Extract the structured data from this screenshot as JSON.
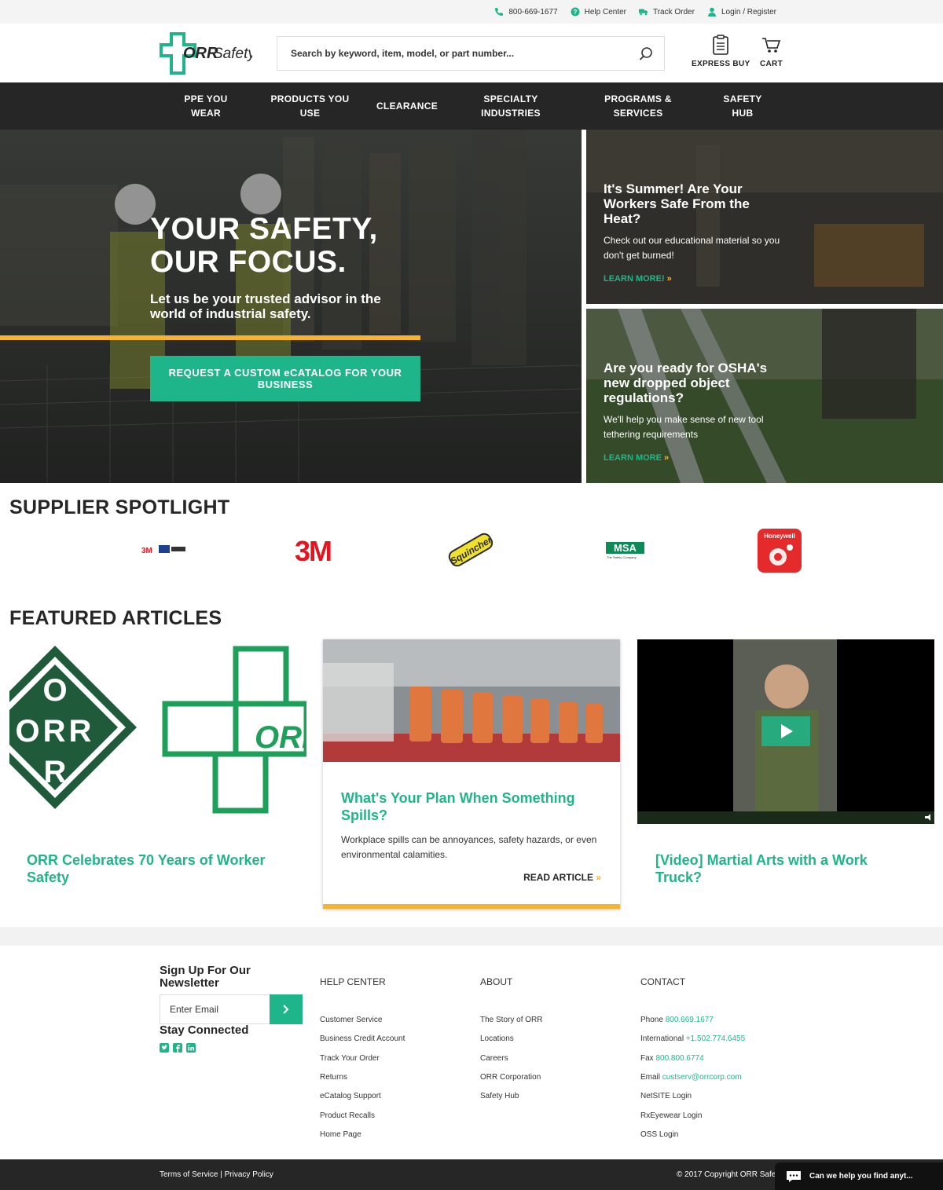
{
  "utility": {
    "phone": "800-669-1677",
    "help": "Help Center",
    "track": "Track Order",
    "login": "Login / Register"
  },
  "header": {
    "logo_text": "ORR Safety",
    "search_placeholder": "Search by keyword, item, model, or part number...",
    "express_buy": "EXPRESS BUY",
    "cart": "CART"
  },
  "nav": [
    {
      "line1": "PPE YOU",
      "line2": "WEAR"
    },
    {
      "line1": "PRODUCTS YOU",
      "line2": "USE"
    },
    {
      "line1": "CLEARANCE",
      "line2": ""
    },
    {
      "line1": "SPECIALTY",
      "line2": "INDUSTRIES"
    },
    {
      "line1": "PROGRAMS &",
      "line2": "SERVICES"
    },
    {
      "line1": "SAFETY",
      "line2": "HUB"
    }
  ],
  "hero": {
    "title_line1": "YOUR SAFETY,",
    "title_line2": "OUR FOCUS.",
    "subtitle": "Let us be your trusted advisor in the world of industrial safety.",
    "cta_line1": "REQUEST A CUSTOM eCATALOG FOR YOUR",
    "cta_line2": "BUSINESS"
  },
  "side_promos": [
    {
      "title": "It's Summer! Are Your Workers Safe From the Heat?",
      "text": "Check out our educational material so you don't get burned!",
      "link": "LEARN MORE!"
    },
    {
      "title": "Are you ready for OSHA's new dropped object regulations?",
      "text": "We'll help you make sense of new tool tethering requirements",
      "link": "LEARN MORE"
    }
  ],
  "supplier": {
    "heading": "SUPPLIER SPOTLIGHT",
    "brands": [
      "3M",
      "3M",
      "Squincher",
      "MSA",
      "Honeywell"
    ],
    "msa_tagline": "The Safety Company"
  },
  "articles": {
    "heading": "FEATURED ARTICLES",
    "items": [
      {
        "title": "ORR Celebrates 70 Years of Worker Safety"
      },
      {
        "title": "What's Your Plan When Something Spills?",
        "text": "Workplace spills can be annoyances, safety hazards, or even environmental calamities.",
        "link": "READ ARTICLE"
      },
      {
        "title": "[Video] Martial Arts with a Work Truck?"
      }
    ]
  },
  "footer": {
    "newsletter_title": "Sign Up For Our Newsletter",
    "email_placeholder": "Enter Email",
    "stay_connected": "Stay Connected",
    "help_heading": "HELP CENTER",
    "help_links": [
      "Customer Service",
      "Business Credit Account",
      "Track Your Order",
      "Returns",
      "eCatalog Support",
      "Product Recalls",
      "Home Page"
    ],
    "about_heading": "ABOUT",
    "about_links": [
      "The Story of ORR",
      "Locations",
      "Careers",
      "ORR Corporation",
      "Safety Hub"
    ],
    "contact_heading": "CONTACT",
    "contact": [
      {
        "label": "Phone",
        "value": "800.669.1677"
      },
      {
        "label": "International",
        "value": "+1.502.774.6455"
      },
      {
        "label": "Fax",
        "value": "800.800.6774"
      },
      {
        "label": "Email",
        "value": "custserv@orrcorp.com"
      }
    ],
    "contact_links": [
      "NetSITE Login",
      "RxEyewear Login",
      "OSS Login"
    ],
    "terms": "Terms of Service",
    "privacy": "Privacy Policy",
    "copyright": "© 2017 Copyright ORR Safe",
    "chat": "Can we help you find anyt..."
  },
  "colors": {
    "accent": "#1fb58a",
    "yellow": "#f5b333",
    "dark": "#262626"
  }
}
